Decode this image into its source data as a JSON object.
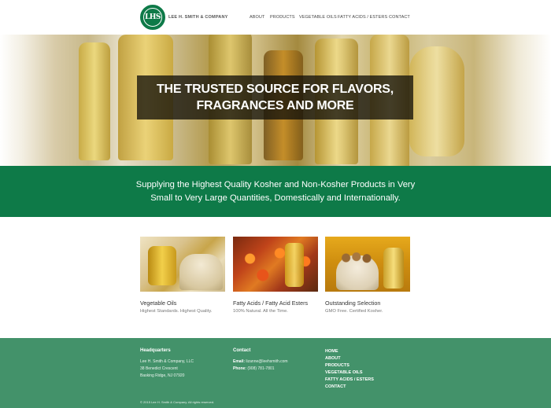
{
  "header": {
    "logo_text": "LHS",
    "company_name": "LEE H. SMITH & COMPANY",
    "nav": [
      {
        "label": "ABOUT"
      },
      {
        "label": "PRODUCTS"
      },
      {
        "label": "VEGETABLE OILS"
      },
      {
        "label": "FATTY ACIDS / ESTERS"
      },
      {
        "label": "CONTACT"
      }
    ]
  },
  "hero": {
    "line1": "THE TRUSTED SOURCE FOR FLAVORS,",
    "line2": "FRAGRANCES AND MORE"
  },
  "band": {
    "line1": "Supplying the Highest Quality Kosher and Non-Kosher Products in Very",
    "line2": "Small to Very Large Quantities, Domestically and Internationally."
  },
  "cards": [
    {
      "title": "Vegetable Oils",
      "subtitle": "Highest Standards. Highest Quality."
    },
    {
      "title": "Fatty Acids / Fatty Acid Esters",
      "subtitle": "100% Natural. All the Time."
    },
    {
      "title": "Outstanding Selection",
      "subtitle": "GMO Free. Certified Kosher."
    }
  ],
  "footer": {
    "headquarters": {
      "heading": "Headquarters",
      "lines": [
        "Lee H. Smith & Company, LLC",
        "38 Benedict Crescent",
        "Basking Ridge, NJ 07920"
      ]
    },
    "contact": {
      "heading": "Contact",
      "email_label": "Email:",
      "email": "lizanne@leehsmith.com",
      "phone_label": "Phone:",
      "phone": "(908) 781-7801"
    },
    "links": [
      "HOME",
      "ABOUT",
      "PRODUCTS",
      "VEGETABLE OILS",
      "FATTY ACIDS / ESTERS",
      "CONTACT"
    ],
    "copyright": "© 2015 Lee H. Smith & Company. All rights reserved."
  },
  "colors": {
    "brand_green": "#0e7a48",
    "footer_green": "#43926a"
  }
}
